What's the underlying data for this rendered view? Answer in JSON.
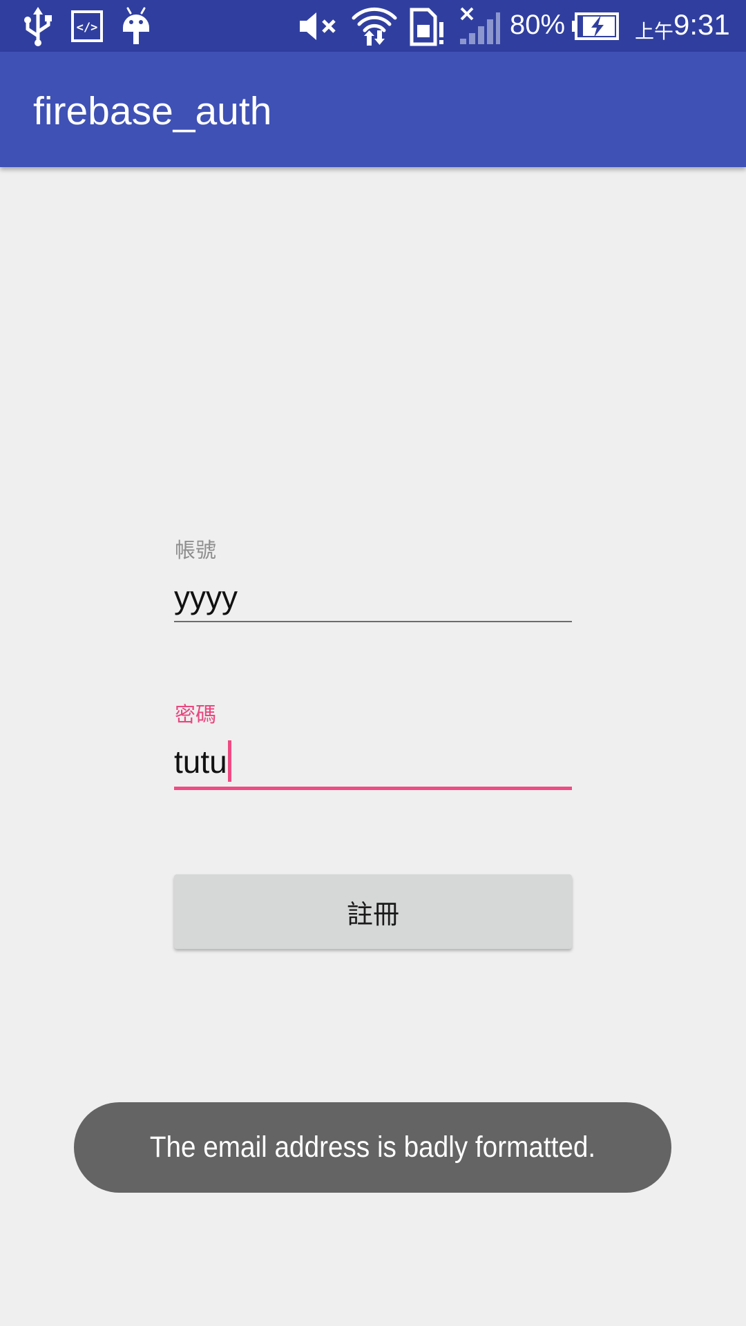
{
  "status_bar": {
    "icons": [
      "usb-icon",
      "developer-code-icon",
      "android-debug-icon",
      "volume-muted-icon",
      "wifi-icon",
      "sim-alert-icon",
      "signal-no-service-icon",
      "battery-charging-icon"
    ],
    "battery_percent": "80%",
    "time_prefix": "上午",
    "time": "9:31",
    "bar_color": "#303f9f"
  },
  "app_bar": {
    "title": "firebase_auth",
    "color": "#3f51b5"
  },
  "form": {
    "username": {
      "label": "帳號",
      "value": "yyyy"
    },
    "password": {
      "label": "密碼",
      "value": "tutu",
      "accent_color": "#ef4a83"
    },
    "register_button": {
      "label": "註冊"
    }
  },
  "toast": {
    "message": "The email address is badly formatted."
  }
}
